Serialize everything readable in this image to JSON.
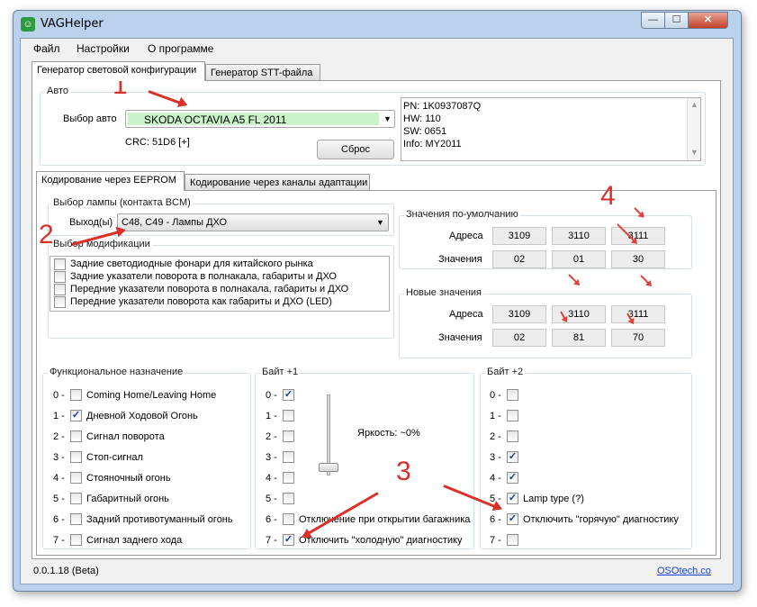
{
  "window": {
    "title": "VAGHelper",
    "app_icon": "app-logo-icon"
  },
  "menu": [
    "Файл",
    "Настройки",
    "О программе"
  ],
  "tabs_top": [
    "Генератор световой конфигурации",
    "Генератор STT-файла"
  ],
  "auto": {
    "group_label": "Авто",
    "select_label": "Выбор авто",
    "selected_car": "SKODA OCTAVIA A5 FL 2011",
    "crc": "CRC: 51D6 [+]",
    "reset_button": "Сброс",
    "info": [
      "PN: 1K0937087Q",
      "HW: 110",
      "SW: 0651",
      "Info: MY2011"
    ]
  },
  "tabs_coding": [
    "Кодирование через EEPROM",
    "Кодирование через каналы адаптации"
  ],
  "lamp": {
    "group_label": "Выбор лампы (контакта BCM)",
    "output_label": "Выход(ы)",
    "output_value": "C48, C49 - Лампы ДХО"
  },
  "mods": {
    "group_label": "Выбор модификации",
    "items": [
      "Задние светодиодные фонари для китайского рынка",
      "Задние указатели поворота в полнакала, габариты и ДХО",
      "Передние указатели поворота в полнакала, габариты и ДХО",
      "Передние указатели поворота как габариты и ДХО (LED)"
    ]
  },
  "defaults": {
    "group_label": "Значения по-умолчанию",
    "addr_label": "Адреса",
    "val_label": "Значения",
    "addresses": [
      "3109",
      "3110",
      "3111"
    ],
    "values": [
      "02",
      "01",
      "30"
    ]
  },
  "new_values": {
    "group_label": "Новые значения",
    "addr_label": "Адреса",
    "val_label": "Значения",
    "addresses": [
      "3109",
      "3110",
      "3111"
    ],
    "values": [
      "02",
      "81",
      "70"
    ]
  },
  "func": {
    "group_label": "Функциональное назначение",
    "items": [
      {
        "idx": "0 -",
        "label": "Coming Home/Leaving Home",
        "checked": false
      },
      {
        "idx": "1 -",
        "label": "Дневной Ходовой Огонь",
        "checked": true
      },
      {
        "idx": "2 -",
        "label": "Сигнал поворота",
        "checked": false
      },
      {
        "idx": "3 -",
        "label": "Стоп-сигнал",
        "checked": false
      },
      {
        "idx": "4 -",
        "label": "Стояночный огонь",
        "checked": false
      },
      {
        "idx": "5 -",
        "label": "Габаритный огонь",
        "checked": false
      },
      {
        "idx": "6 -",
        "label": "Задний противотуманный огонь",
        "checked": false
      },
      {
        "idx": "7 -",
        "label": "Сигнал заднего хода",
        "checked": false
      }
    ]
  },
  "byte1": {
    "group_label": "Байт +1",
    "brightness": "Яркость: ~0%",
    "brightness_level": 0,
    "items": [
      {
        "idx": "0 -",
        "label": "",
        "checked": true
      },
      {
        "idx": "1 -",
        "label": "",
        "checked": false
      },
      {
        "idx": "2 -",
        "label": "",
        "checked": false
      },
      {
        "idx": "3 -",
        "label": "",
        "checked": false
      },
      {
        "idx": "4 -",
        "label": "",
        "checked": false
      },
      {
        "idx": "5 -",
        "label": "",
        "checked": false
      },
      {
        "idx": "6 -",
        "label": "Отключение при открытии багажника",
        "checked": false
      },
      {
        "idx": "7 -",
        "label": "Отключить \"холодную\" диагностику",
        "checked": true
      }
    ]
  },
  "byte2": {
    "group_label": "Байт +2",
    "items": [
      {
        "idx": "0 -",
        "label": "",
        "checked": false
      },
      {
        "idx": "1 -",
        "label": "",
        "checked": false
      },
      {
        "idx": "2 -",
        "label": "",
        "checked": false
      },
      {
        "idx": "3 -",
        "label": "",
        "checked": true
      },
      {
        "idx": "4 -",
        "label": "",
        "checked": true
      },
      {
        "idx": "5 -",
        "label": "Lamp type (?)",
        "checked": true
      },
      {
        "idx": "6 -",
        "label": "Отключить \"горячую\" диагностику",
        "checked": true
      },
      {
        "idx": "7 -",
        "label": "",
        "checked": false
      }
    ]
  },
  "status": {
    "version": "0.0.1.18 (Beta)",
    "link": "OSOtech.co"
  },
  "annotations": [
    "1",
    "2",
    "3",
    "4"
  ],
  "colors": {
    "annotation": "#d9302a",
    "selected_car_bg": "#c9f2c9",
    "link": "#1a3fd6"
  }
}
